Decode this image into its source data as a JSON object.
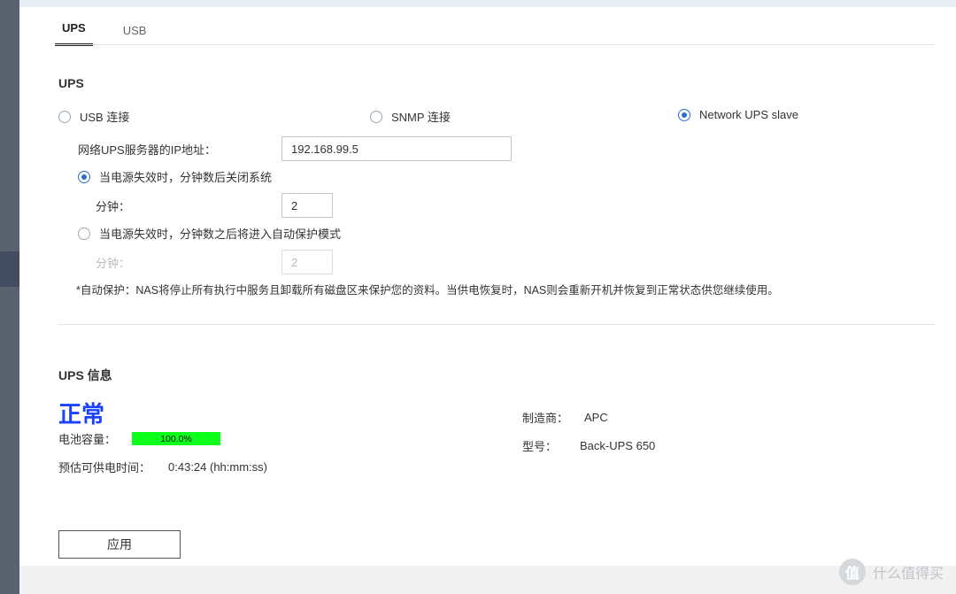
{
  "tabs": {
    "active": "UPS",
    "items": [
      "UPS",
      "USB"
    ]
  },
  "section": {
    "title": "UPS"
  },
  "connection": {
    "options": [
      {
        "label": "USB 连接",
        "checked": false
      },
      {
        "label": "SNMP 连接",
        "checked": false
      },
      {
        "label": "Network UPS slave",
        "checked": true
      }
    ]
  },
  "ip": {
    "label": "网络UPS服务器的IP地址：",
    "value": "192.168.99.5"
  },
  "shutdown_mode": {
    "options": [
      {
        "label": "当电源失效时，分钟数后关闭系统",
        "checked": true,
        "minute_label": "分钟：",
        "minute_value": "2"
      },
      {
        "label": "当电源失效时，分钟数之后将进入自动保护模式",
        "checked": false,
        "minute_label": "分钟：",
        "minute_value": "2"
      }
    ]
  },
  "note": "*自动保护：NAS将停止所有执行中服务且卸载所有磁盘区来保护您的资料。当供电恢复时，NAS则会重新开机并恢复到正常状态供您继续使用。",
  "info": {
    "title": "UPS 信息",
    "status": "正常",
    "battery_label": "电池容量：",
    "battery_percent": "100.0%",
    "runtime_label": "预估可供电时间：",
    "runtime_value": "0:43:24 (hh:mm:ss)",
    "mfr_label": "制造商：",
    "mfr_value": "APC",
    "model_label": "型号：",
    "model_value": "Back-UPS 650"
  },
  "apply_label": "应用",
  "watermark": {
    "badge": "值",
    "text": "什么值得买"
  }
}
